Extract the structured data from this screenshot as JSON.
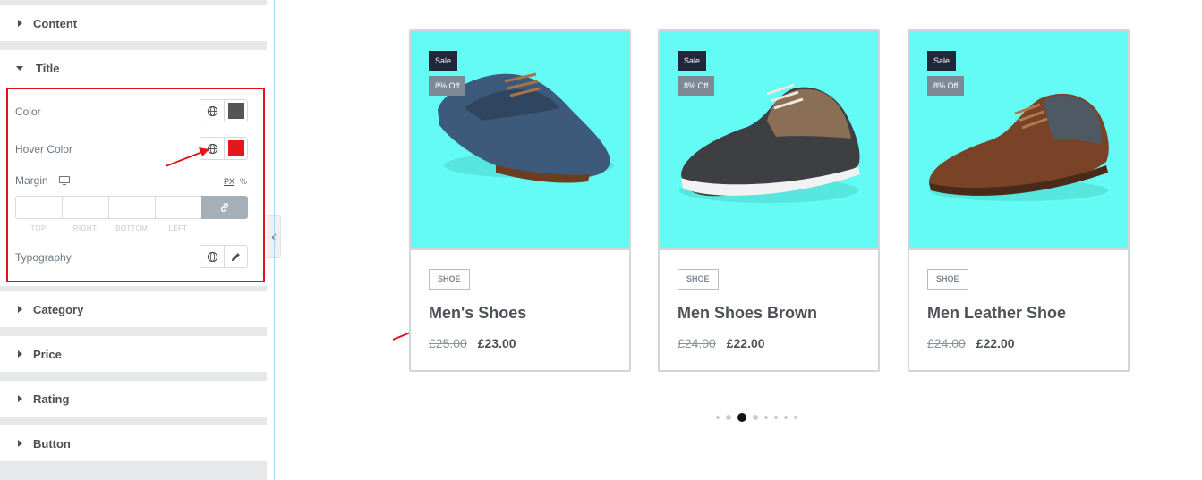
{
  "panel": {
    "sections_top": [
      {
        "label": "Content",
        "expanded": false
      },
      {
        "label": "Title",
        "expanded": true
      }
    ],
    "title_controls": {
      "color_label": "Color",
      "color_value": "#555555",
      "hover_color_label": "Hover Color",
      "hover_color_value": "#e3171e",
      "margin_label": "Margin",
      "unit_px": "PX",
      "unit_pct": "%",
      "dim_top": "TOP",
      "dim_right": "RIGHT",
      "dim_bottom": "BOTTOM",
      "dim_left": "LEFT",
      "typography_label": "Typography"
    },
    "sections_bottom": [
      {
        "label": "Category",
        "expanded": false
      },
      {
        "label": "Price",
        "expanded": false
      },
      {
        "label": "Rating",
        "expanded": false
      },
      {
        "label": "Button",
        "expanded": false
      }
    ]
  },
  "products": [
    {
      "sale": "Sale",
      "discount": "8% Off",
      "category": "SHOE",
      "title": "Men's Shoes",
      "old_price": "£25.00",
      "price": "£23.00",
      "shoe": "blue-oxford"
    },
    {
      "sale": "Sale",
      "discount": "8% Off",
      "category": "SHOE",
      "title": "Men Shoes Brown",
      "old_price": "£24.00",
      "price": "£22.00",
      "shoe": "grey-sneaker"
    },
    {
      "sale": "Sale",
      "discount": "8% Off",
      "category": "SHOE",
      "title": "Men Leather Shoe",
      "old_price": "£24.00",
      "price": "£22.00",
      "shoe": "brown-oxford"
    }
  ],
  "carousel": {
    "dot_count": 8,
    "active_index": 2
  },
  "colors": {
    "accent_red": "#e2131a",
    "card_bg": "#63fbf3",
    "sale_badge": "#22263a",
    "discount_badge": "#7d8a96"
  }
}
